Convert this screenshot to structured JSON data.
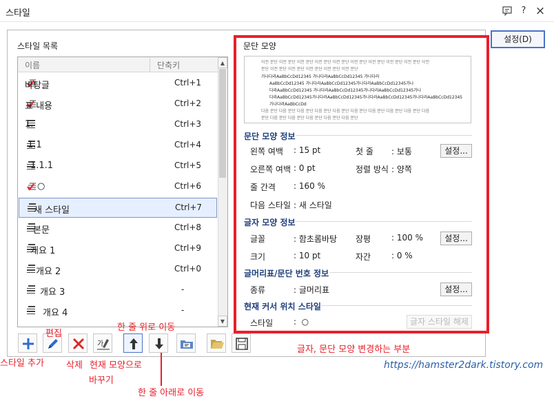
{
  "window": {
    "title": "스타일",
    "icons": [
      "message-icon",
      "help-icon",
      "close-icon"
    ],
    "help_glyph": "?",
    "close_glyph": "×"
  },
  "style_list": {
    "caption": "스타일 목록",
    "col_name": "이름",
    "col_key": "단축키",
    "rows": [
      {
        "name": "바탕글",
        "key": "Ctrl+1",
        "icon": "check-paragraph-icon"
      },
      {
        "name": "표 내용",
        "key": "Ctrl+2",
        "icon": "check-paragraph-icon"
      },
      {
        "name": "1.",
        "key": "Ctrl+3",
        "icon": "paragraph-lines-icon"
      },
      {
        "name": "1.1",
        "key": "Ctrl+4",
        "icon": "paragraph-lines-icon"
      },
      {
        "name": "1.1.1",
        "key": "Ctrl+5",
        "icon": "paragraph-lines-icon"
      },
      {
        "name": "○",
        "key": "Ctrl+6",
        "icon": "check-paragraph-icon"
      },
      {
        "name": "새 스타일",
        "key": "Ctrl+7",
        "icon": "paragraph-lines-icon",
        "selected": true
      },
      {
        "name": "본문",
        "key": "Ctrl+8",
        "icon": "paragraph-lines-icon"
      },
      {
        "name": "개요 1",
        "key": "Ctrl+9",
        "icon": "paragraph-lines-icon"
      },
      {
        "name": "개요 2",
        "key": "Ctrl+0",
        "icon": "paragraph-lines-icon"
      },
      {
        "name": "개요 3",
        "key": "-",
        "icon": "paragraph-lines-icon"
      },
      {
        "name": "개요 4",
        "key": "-",
        "icon": "paragraph-lines-icon"
      }
    ]
  },
  "toolbar": {
    "buttons": [
      "add-style",
      "edit-style",
      "delete-style",
      "replace-with-current",
      "move-up",
      "move-down",
      "import-style",
      "open-style",
      "save-style"
    ]
  },
  "annotations": {
    "add": "스타일 추가",
    "edit": "편집",
    "delete": "삭제",
    "replace_line1": "현재 모양으로",
    "replace_line2": "바꾸기",
    "move_up": "한 줄 위로 이동",
    "move_down": "한 줄 아래로 이동",
    "right_panel": "글자, 문단 모양 변경하는 부분"
  },
  "paragraph": {
    "caption": "문단 모양",
    "preview_lines": [
      "이전 문단 이전 문단 이전 문단 이전 문단 이전 문단 이전 문단 이전 문단 이전 문단 이전 문단 이전",
      "문단 이전 문단 이전 문단 이전 문단 이전 문단 이전 문단",
      "가나다라AaBbCcDd12345      가나다라AaBbCcDd12345      가나다라",
      "AaBbCcDd12345   가나다라AaBbCcDd12345가나다라AaBbCcDd12345가나",
      "다라AaBbCcDd12345   가나다라AaBbCcDd12345가나다라AaBbCcDd12345가나",
      "다라AaBbCcDd12345가나다라AaBbCcDd12345가나다라AaBbCcDd12345가나다라AaBbCcDd12345",
      "가나다라AaBbCcDd",
      "다음 문단 다음 문단 다음 문단 다음 문단 다음 문단 다음 문단 다음 문단 다음 문단 다음 문단 다음",
      "문단 다음 문단 다음 문단 다음 문단 다음 문단 다음 문단"
    ],
    "info_title": "문단 모양 정보",
    "left_margin_label": "왼쪽 여백",
    "left_margin_value": ": 15 pt",
    "first_line_label": "첫 줄",
    "first_line_value": ": 보통",
    "right_margin_label": "오른쪽 여백",
    "right_margin_value": ": 0 pt",
    "align_label": "정렬 방식",
    "align_value": ": 양쪽",
    "line_spacing_label": "줄 간격",
    "line_spacing_value": ": 160 %",
    "next_style_label": "다음 스타일",
    "next_style_value": ": 새 스타일",
    "setting_label": "설정..."
  },
  "char": {
    "title": "글자 모양 정보",
    "font_label": "글꼴",
    "font_value": ": 함초롬바탕",
    "width_label": "장평",
    "width_value": ": 100 %",
    "size_label": "크기",
    "size_value": ": 10 pt",
    "spacing_label": "자간",
    "spacing_value": ": 0 %",
    "setting_label": "설정..."
  },
  "numbering": {
    "title": "글머리표/문단 번호 정보",
    "kind_label": "종류",
    "kind_value": ": 글머리표",
    "setting_label": "설정..."
  },
  "cursor_style": {
    "title": "현재 커서 위치 스타일",
    "style_label": "스타일",
    "style_value": ":  ○",
    "apply_label": "글자 스타일 해제"
  },
  "main_setting": "설정(D)",
  "watermark": "https://hamster2dark.tistory.com",
  "colors": {
    "annotation_red": "#e8202a",
    "section_blue": "#1f3f7a",
    "accent_blue": "#4a72c9"
  }
}
